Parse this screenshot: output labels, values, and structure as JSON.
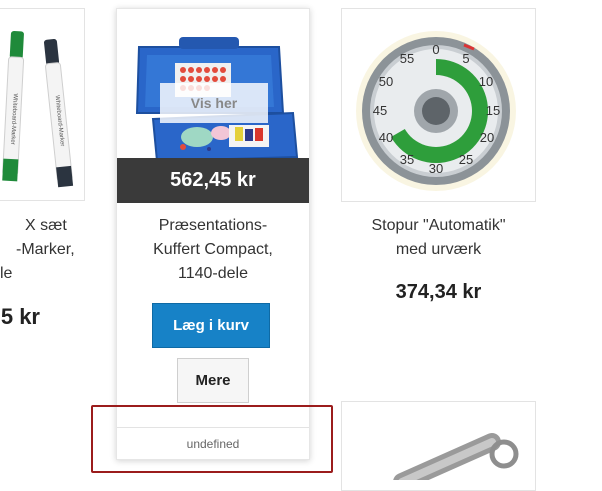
{
  "products": {
    "left": {
      "title_line1": "X sæt",
      "title_line2": "-Marker,",
      "title_line3": "le",
      "price": "5 kr",
      "marker_label": "Whiteboard-Marker",
      "colors": {
        "cap_green": "#1f8a3a",
        "cap_dark": "#2b3440"
      }
    },
    "featured": {
      "overlay_label": "Vis her",
      "price": "562,45 kr",
      "title_line1": "Præsentations-",
      "title_line2": "Kuffert Compact,",
      "title_line3": "1140-dele",
      "add_to_cart_label": "Læg i kurv",
      "more_label": "Mere",
      "footer_text": "undefined",
      "colors": {
        "case_blue": "#2a66c9",
        "button_blue": "#1782c7",
        "price_band": "#3a3a3a",
        "highlight": "#9b1c1c"
      }
    },
    "right": {
      "title_line1": "Stopur \"Automatik\"",
      "title_line2": "med urværk",
      "price": "374,34 kr",
      "dial_numbers": [
        "0",
        "5",
        "10",
        "15",
        "20",
        "25",
        "30",
        "35",
        "40",
        "45",
        "50",
        "55"
      ],
      "colors": {
        "dial_green": "#2e9e3b",
        "bezel": "#8c9398"
      }
    }
  }
}
